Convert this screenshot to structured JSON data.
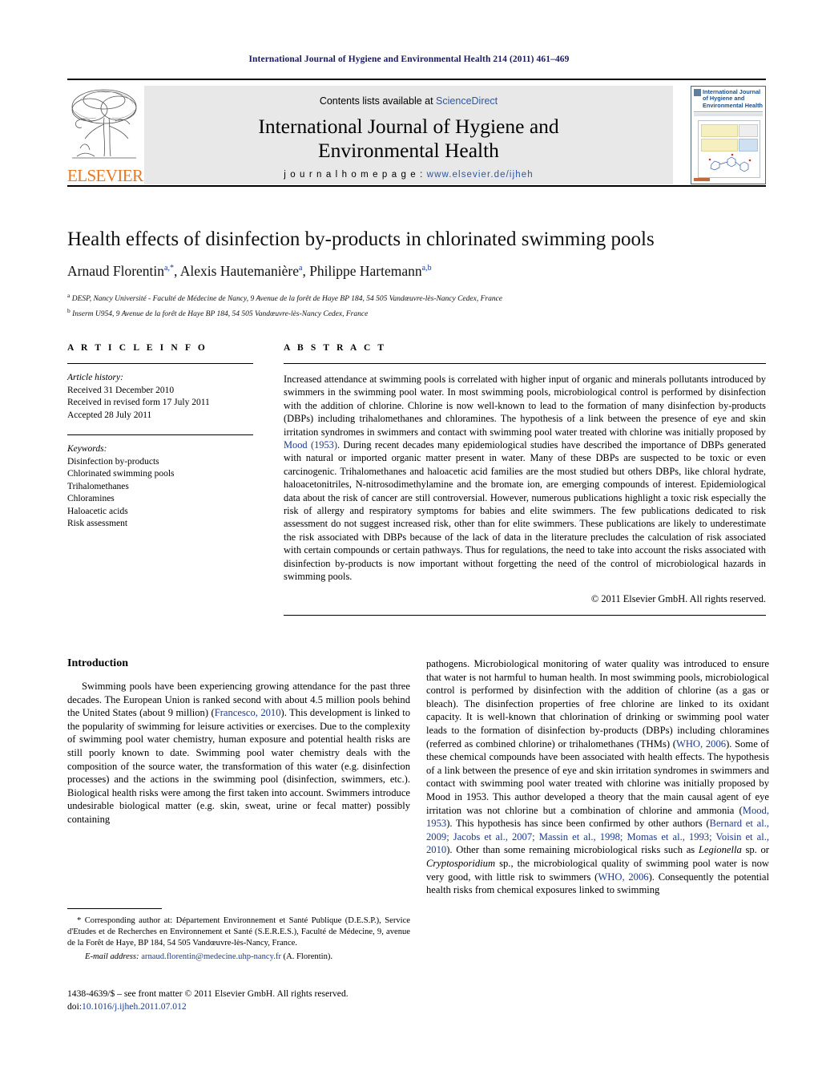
{
  "running_head": "International Journal of Hygiene and Environmental Health 214 (2011) 461–469",
  "masthead": {
    "contents_prefix": "Contents lists available at ",
    "contents_link": "ScienceDirect",
    "journal_title_line1": "International Journal of Hygiene and",
    "journal_title_line2": "Environmental Health",
    "homepage_label": "j o u r n a l   h o m e p a g e :  ",
    "homepage_url": "www.elsevier.de/ijheh",
    "publisher": "ELSEVIER",
    "cover_title_line1": "International Journal",
    "cover_title_line2": "of Hygiene and",
    "cover_title_line3": "Environmental Health"
  },
  "title": "Health effects of disinfection by-products in chlorinated swimming pools",
  "authors": [
    {
      "name": "Arnaud Florentin",
      "sup": "a,*"
    },
    {
      "name": "Alexis Hautemanière",
      "sup": "a"
    },
    {
      "name": "Philippe Hartemann",
      "sup": "a,b"
    }
  ],
  "affiliations": [
    {
      "marker": "a",
      "text": "DESP, Nancy Université - Faculté de Médecine de Nancy, 9 Avenue de la forêt de Haye BP 184, 54 505 Vandœuvre-lès-Nancy Cedex, France"
    },
    {
      "marker": "b",
      "text": "Inserm U954, 9 Avenue de la forêt de Haye BP 184, 54 505 Vandœuvre-lès-Nancy Cedex, France"
    }
  ],
  "article_info": {
    "heading": "A R T I C L E    I N F O",
    "history_label": "Article history:",
    "history": [
      "Received 31 December 2010",
      "Received in revised form 17 July 2011",
      "Accepted 28 July 2011"
    ],
    "keywords_label": "Keywords:",
    "keywords": [
      "Disinfection by-products",
      "Chlorinated swimming pools",
      "Trihalomethanes",
      "Chloramines",
      "Haloacetic acids",
      "Risk assessment"
    ]
  },
  "abstract": {
    "heading": "A B S T R A C T",
    "part1": "Increased attendance at swimming pools is correlated with higher input of organic and minerals pollutants introduced by swimmers in the swimming pool water. In most swimming pools, microbiological control is performed by disinfection with the addition of chlorine. Chlorine is now well-known to lead to the formation of many disinfection by-products (DBPs) including trihalomethanes and chloramines. The hypothesis of a link between the presence of eye and skin irritation syndromes in swimmers and contact with swimming pool water treated with chlorine was initially proposed by ",
    "ref1": "Mood (1953)",
    "part2": ". During recent decades many epidemiological studies have described the importance of DBPs generated with natural or imported organic matter present in water. Many of these DBPs are suspected to be toxic or even carcinogenic. Trihalomethanes and haloacetic acid families are the most studied but others DBPs, like chloral hydrate, haloacetonitriles, N-nitrosodimethylamine and the bromate ion, are emerging compounds of interest. Epidemiological data about the risk of cancer are still controversial. However, numerous publications highlight a toxic risk especially the risk of allergy and respiratory symptoms for babies and elite swimmers. The few publications dedicated to risk assessment do not suggest increased risk, other than for elite swimmers. These publications are likely to underestimate the risk associated with DBPs because of the lack of data in the literature precludes the calculation of risk associated with certain compounds or certain pathways. Thus for regulations, the need to take into account the risks associated with disinfection by-products is now important without forgetting the need of the control of microbiological hazards in swimming pools.",
    "copyright": "© 2011 Elsevier GmbH. All rights reserved."
  },
  "introduction": {
    "heading": "Introduction",
    "left_p1_a": "Swimming pools have been experiencing growing attendance for the past three decades. The European Union is ranked second with about 4.5 million pools behind the United States (about 9 million) (",
    "left_ref1": "Francesco, 2010",
    "left_p1_b": "). This development is linked to the popularity of swimming for leisure activities or exercises. Due to the complexity of swimming pool water chemistry, human exposure and potential health risks are still poorly known to date. Swimming pool water chemistry deals with the composition of the source water, the transformation of this water (e.g. disinfection processes) and the actions in the swimming pool (disinfection, swimmers, etc.). Biological health risks were among the first taken into account. Swimmers introduce undesirable biological matter (e.g. skin, sweat, urine or fecal matter) possibly containing",
    "right_p1_a": "pathogens. Microbiological monitoring of water quality was introduced to ensure that water is not harmful to human health. In most swimming pools, microbiological control is performed by disinfection with the addition of chlorine (as a gas or bleach). The disinfection properties of free chlorine are linked to its oxidant capacity. It is well-known that chlorination of drinking or swimming pool water leads to the formation of disinfection by-products (DBPs) including chloramines (referred as combined chlorine) or trihalomethanes (THMs) (",
    "right_ref1": "WHO, 2006",
    "right_p1_b": "). Some of these chemical compounds have been associated with health effects. The hypothesis of a link between the presence of eye and skin irritation syndromes in swimmers and contact with swimming pool water treated with chlorine was initially proposed by Mood in 1953. This author developed a theory that the main causal agent of eye irritation was not chlorine but a combination of chlorine and ammonia (",
    "right_ref2": "Mood, 1953",
    "right_p1_c": "). This hypothesis has since been confirmed by other authors (",
    "right_ref3": "Bernard et al., 2009; Jacobs et al., 2007; Massin et al., 1998; Momas et al., 1993; Voisin et al., 2010",
    "right_p1_d": "). Other than some remaining microbiological risks such as ",
    "right_ital1": "Legionella",
    "right_p1_e": " sp. or ",
    "right_ital2": "Cryptosporidium",
    "right_p1_f": " sp., the microbiological quality of swimming pool water is now very good, with little risk to swimmers (",
    "right_ref4": "WHO, 2006",
    "right_p1_g": "). Consequently the potential health risks from chemical exposures linked to swimming"
  },
  "footnotes": {
    "corresponding": "* Corresponding author at: Département Environnement et Santé Publique (D.E.S.P.), Service d'Etudes et de Recherches en Environnement et Santé (S.E.R.E.S.), Faculté de Médecine, 9, avenue de la Forêt de Haye, BP 184, 54 505 Vandœuvre-lès-Nancy, France.",
    "email_label": "E-mail address:",
    "email": "arnaud.florentin@medecine.uhp-nancy.fr",
    "email_suffix": " (A. Florentin)."
  },
  "issn": {
    "line1": "1438-4639/$ – see front matter © 2011 Elsevier GmbH. All rights reserved.",
    "doi_label": "doi:",
    "doi_value": "10.1016/j.ijheh.2011.07.012"
  },
  "colors": {
    "link": "#1a3a8f",
    "sciencedirect": "#2b57a8",
    "elsevier_orange": "#e87722",
    "running_head": "#1a1a5e",
    "band_grey": "#e8e8e8"
  }
}
